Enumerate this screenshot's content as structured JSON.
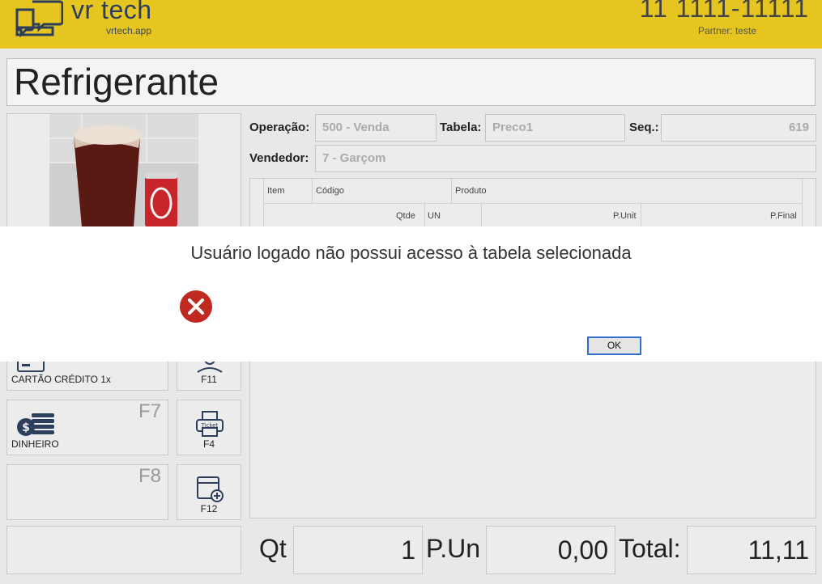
{
  "header": {
    "brand_name": "vr tech",
    "brand_url": "vrtech.app",
    "phone": "11 1111-11111",
    "partner": "Partner: teste",
    "background_color": "#e6c520"
  },
  "product": {
    "title": "Refrigerante"
  },
  "form": {
    "operacao_label": "Operação:",
    "operacao_value": "500 - Venda",
    "tabela_label": "Tabela:",
    "tabela_value": "Preco1",
    "seq_label": "Seq.:",
    "seq_value": "619",
    "vendedor_label": "Vendedor:",
    "vendedor_value": "7 - Garçom"
  },
  "grid": {
    "header_row1": [
      "Item",
      "Código",
      "Produto"
    ],
    "header_row2": [
      "Qtde",
      "UN",
      "P.Unit",
      "P.Final"
    ]
  },
  "buttons": {
    "credit_caption": "CARTÃO CRÉDITO 1x",
    "f11_caption": "F11",
    "f7_key": "F7",
    "dinheiro_caption": "DINHEIRO",
    "f4_caption": "F4",
    "f8_key": "F8",
    "f12_caption": "F12",
    "ticket_text": "Ticket"
  },
  "totals": {
    "qt_label": "Qt",
    "qt_value": "1",
    "pun_label": "P.Un",
    "pun_value": "0,00",
    "total_label": "Total:",
    "total_value": "11,11"
  },
  "dialog": {
    "message": "Usuário logado não possui acesso à tabela selecionada",
    "ok_label": "OK",
    "icon": "error-icon",
    "icon_color": "#c0291f"
  }
}
